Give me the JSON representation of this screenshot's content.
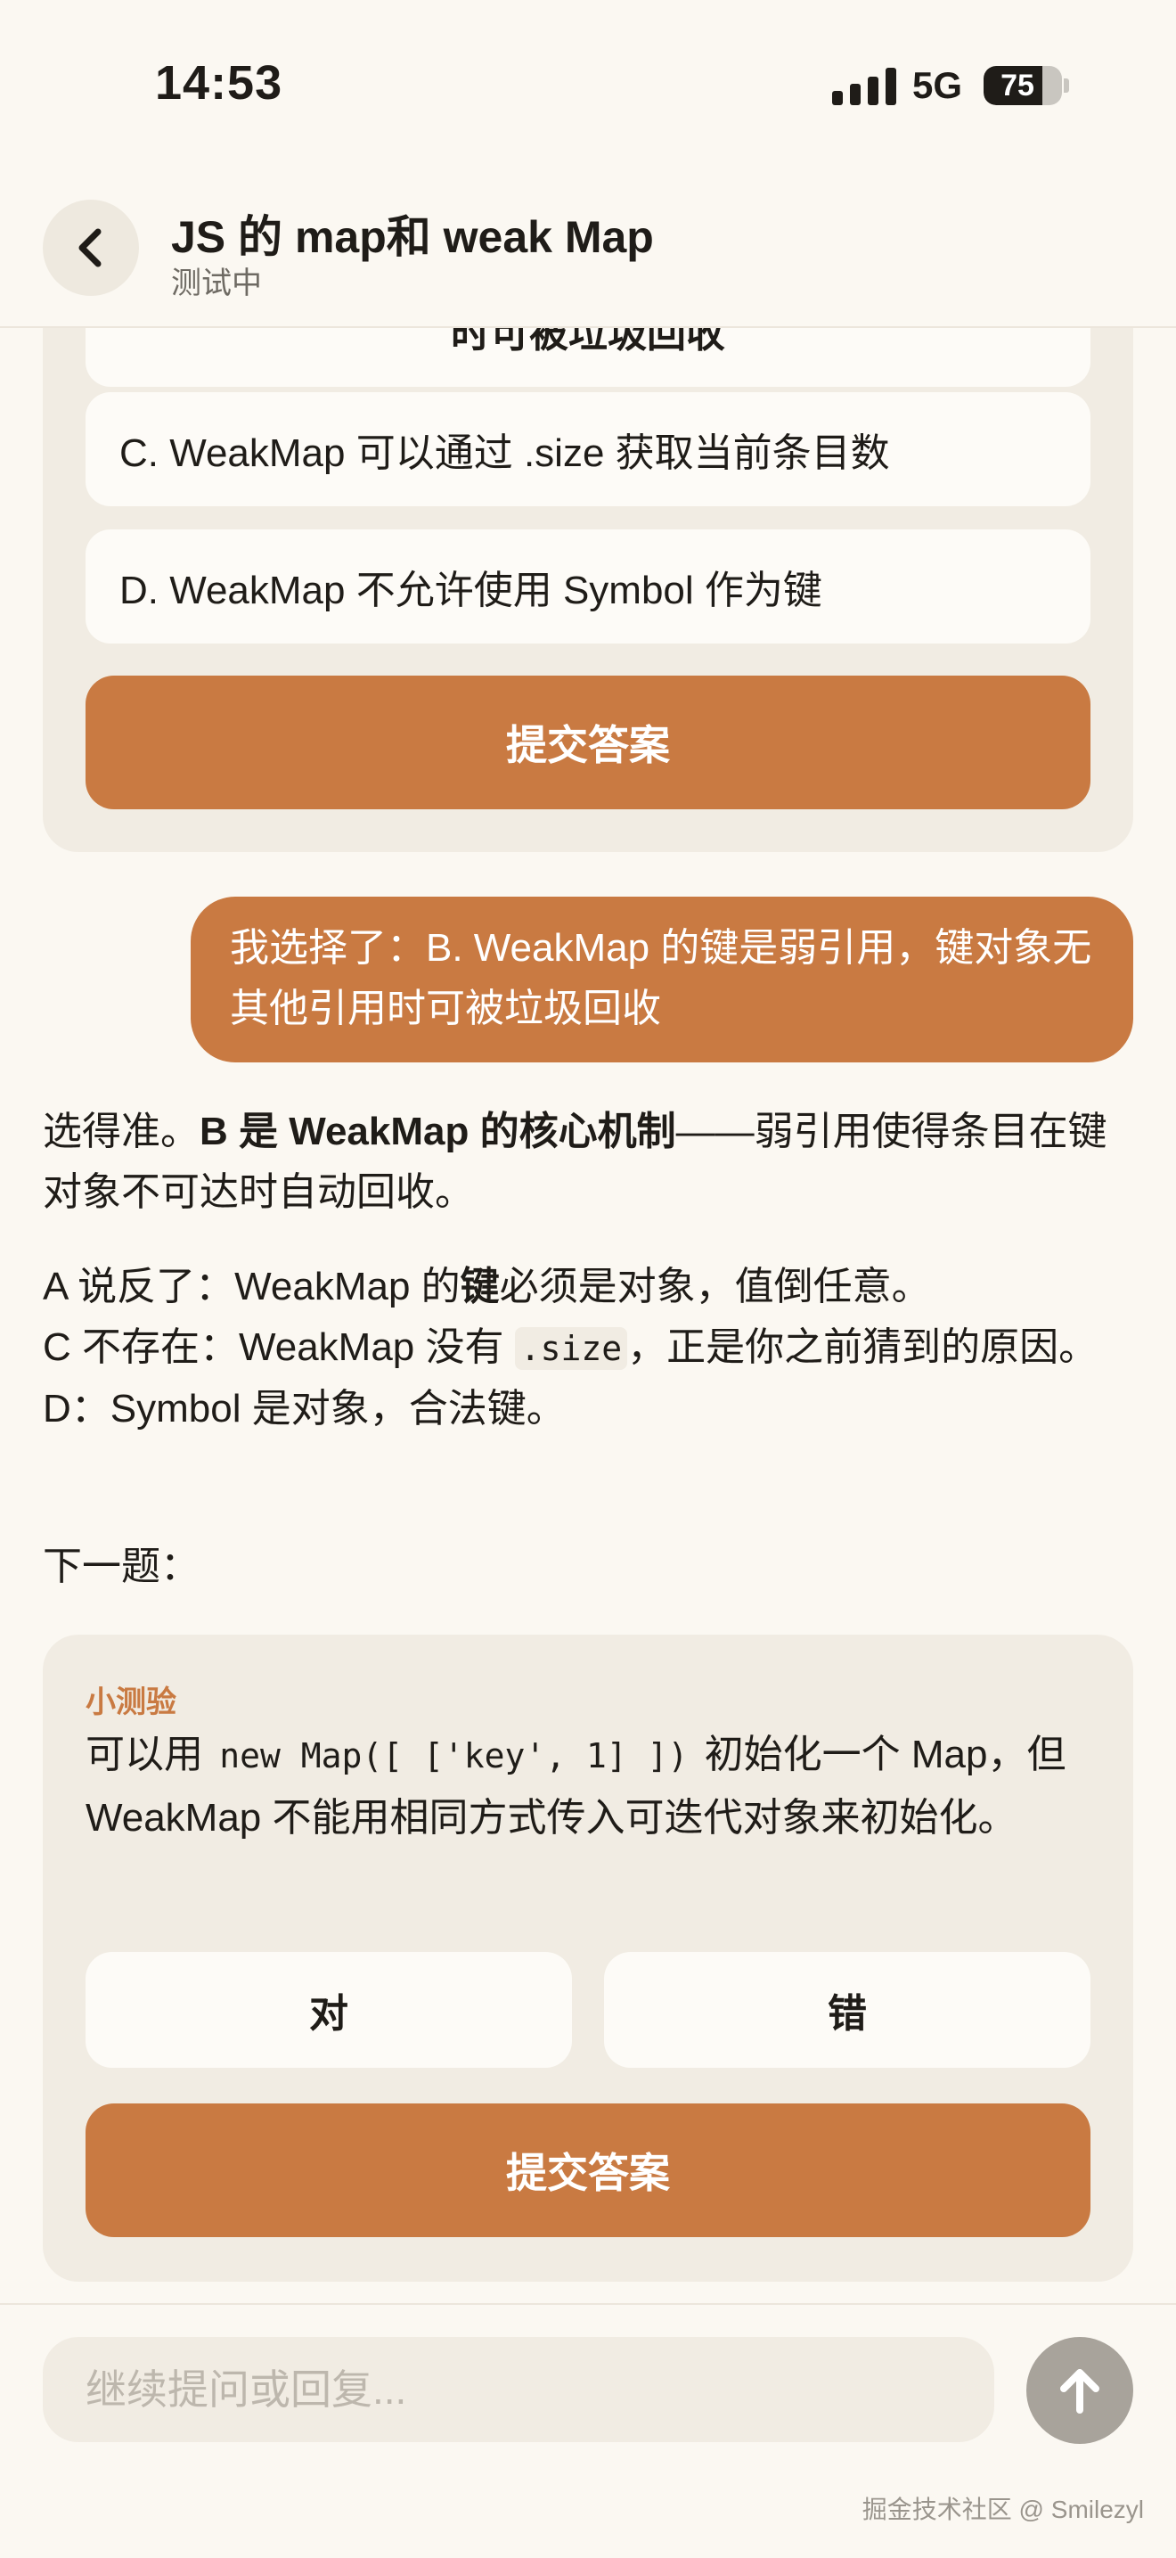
{
  "status_bar": {
    "time": "14:53",
    "network": "5G",
    "battery": "75",
    "battery_level": 0.75
  },
  "header": {
    "title": "JS 的 map和 weak Map",
    "subtitle": "测试中"
  },
  "question1": {
    "option_b_partial": "时可被垃圾回收",
    "option_c": "C. WeakMap 可以通过 .size 获取当前条目数",
    "option_d": "D. WeakMap 不允许使用 Symbol 作为键",
    "submit_label": "提交答案"
  },
  "user_message": "我选择了：B. WeakMap 的键是弱引用，键对象无其他引用时可被垃圾回收",
  "assistant_reply": {
    "p1_prefix": "选得准。",
    "p1_bold": "B 是 WeakMap 的核心机制",
    "p1_suffix": "——弱引用使得条目在键对象不可达时自动回收。",
    "a_line_1": "A 说反了：WeakMap 的",
    "a_line_bold": "键",
    "a_line_2": "必须是对象，值倒任意。",
    "c_line_1": "C 不存在：WeakMap 没有 ",
    "c_line_code": ".size",
    "c_line_2": "，正是你之前猜到的原因。",
    "d_line": "D：Symbol 是对象，合法键。",
    "next": "下一题："
  },
  "quiz": {
    "label": "小测验",
    "question_1": "可以用 ",
    "question_code": "new Map([ ['key', 1] ])",
    "question_2": " 初始化一个 Map，但 WeakMap 不能用相同方式传入可迭代对象来初始化。",
    "true_label": "对",
    "false_label": "错",
    "submit_label": "提交答案"
  },
  "composer": {
    "placeholder": "继续提问或回复..."
  },
  "watermark": "掘金技术社区 @ Smilezyl",
  "colors": {
    "accent": "#c97a42",
    "card": "#f1ece3",
    "background": "#fbf8f2"
  },
  "icons": {
    "back": "chevron-left-icon",
    "send": "arrow-up-icon"
  }
}
